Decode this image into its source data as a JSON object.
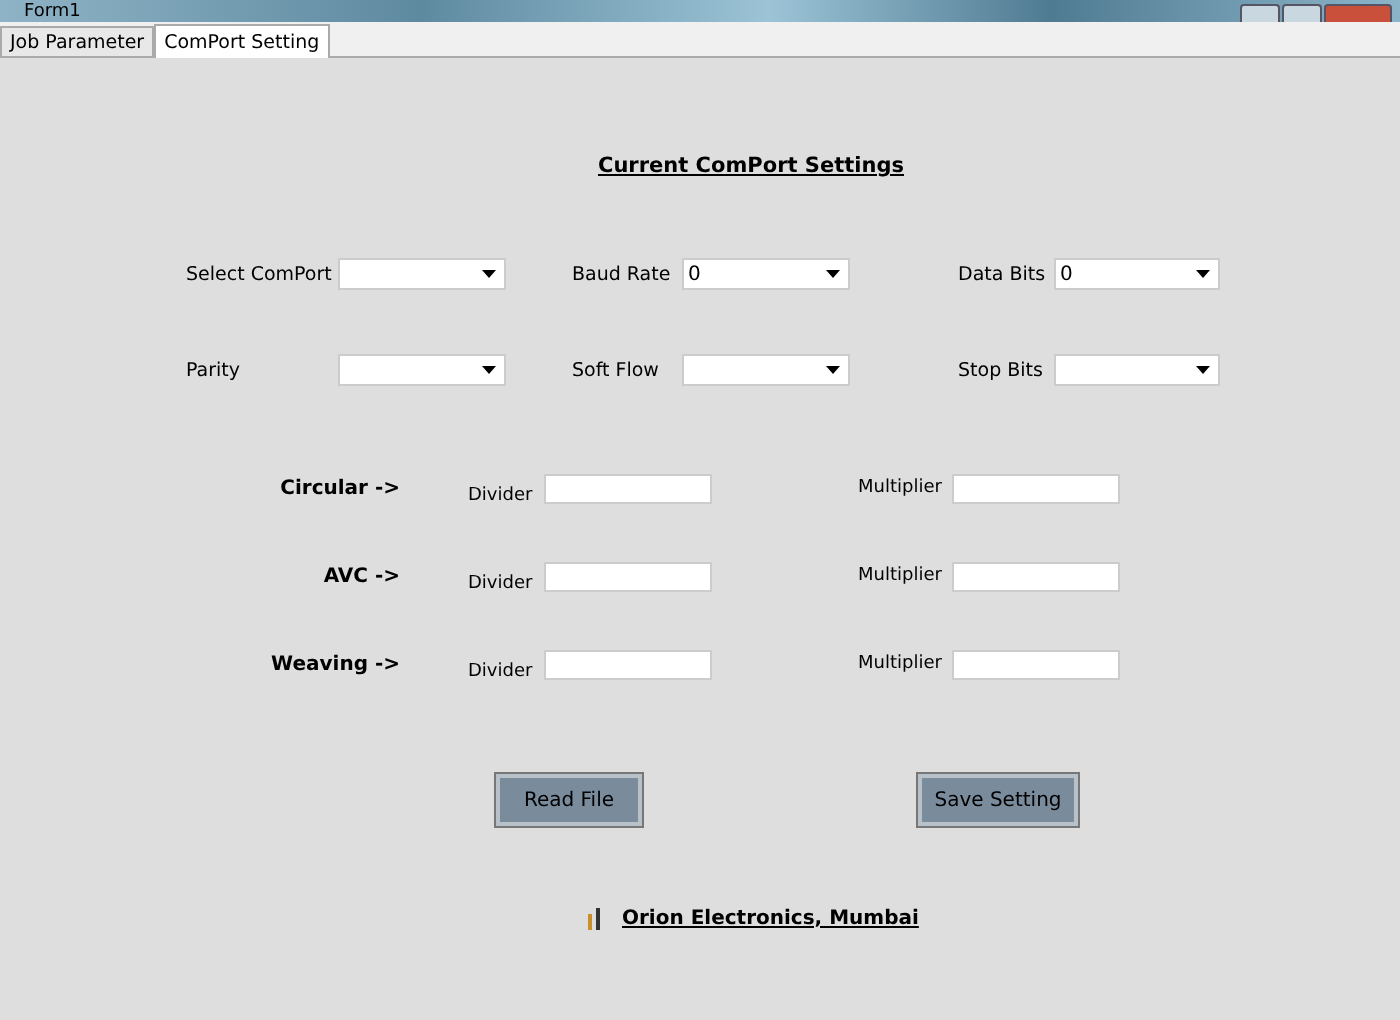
{
  "window": {
    "title": "Form1"
  },
  "tabs": [
    {
      "label": "Job Parameter",
      "selected": false
    },
    {
      "label": "ComPort Setting",
      "selected": true
    }
  ],
  "heading": "Current ComPort Settings",
  "combo_rows": [
    [
      {
        "label": "Select ComPort"
      },
      {
        "label": "Baud Rate",
        "value": "0"
      },
      {
        "label": "Data Bits",
        "value": "0"
      }
    ],
    [
      {
        "label": "Parity"
      },
      {
        "label": "Soft Flow"
      },
      {
        "label": "Stop Bits"
      }
    ]
  ],
  "scaling_rows": [
    {
      "name": "Circular ->",
      "divider_label": "Divider",
      "multiplier_label": "Multiplier"
    },
    {
      "name": "AVC ->",
      "divider_label": "Divider",
      "multiplier_label": "Multiplier"
    },
    {
      "name": "Weaving ->",
      "divider_label": "Divider",
      "multiplier_label": "Multiplier"
    }
  ],
  "buttons": [
    "Read File",
    "Save Setting"
  ],
  "footer": "Orion Electronics, Mumbai"
}
